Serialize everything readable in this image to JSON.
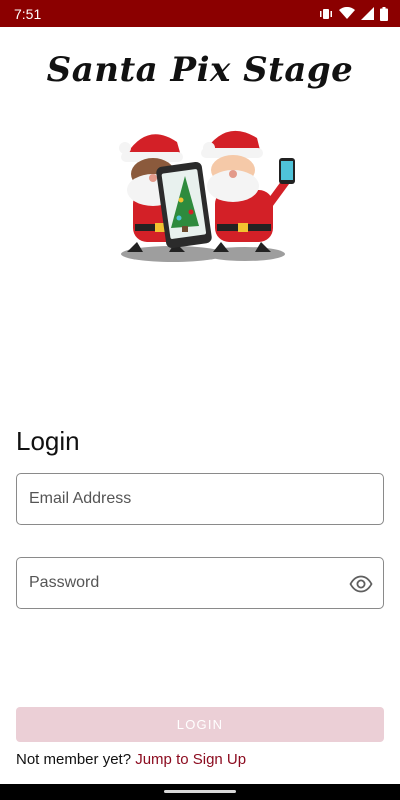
{
  "status_bar": {
    "time": "7:51",
    "icons": [
      "vibrate-icon",
      "wifi-icon",
      "signal-icon",
      "battery-icon"
    ],
    "background_color": "#8b0000"
  },
  "app": {
    "title": "Santa Pix Stage",
    "hero_image": "santas-with-phone-illustration"
  },
  "login": {
    "heading": "Login",
    "email_placeholder": "Email Address",
    "email_value": "",
    "password_placeholder": "Password",
    "password_value": "",
    "password_toggle_icon": "eye-icon",
    "button_label": "LOGIN",
    "button_color": "#ebcfd6"
  },
  "signup": {
    "prompt": "Not member yet?",
    "link": "Jump to Sign Up",
    "link_color": "#8b0a1e"
  }
}
